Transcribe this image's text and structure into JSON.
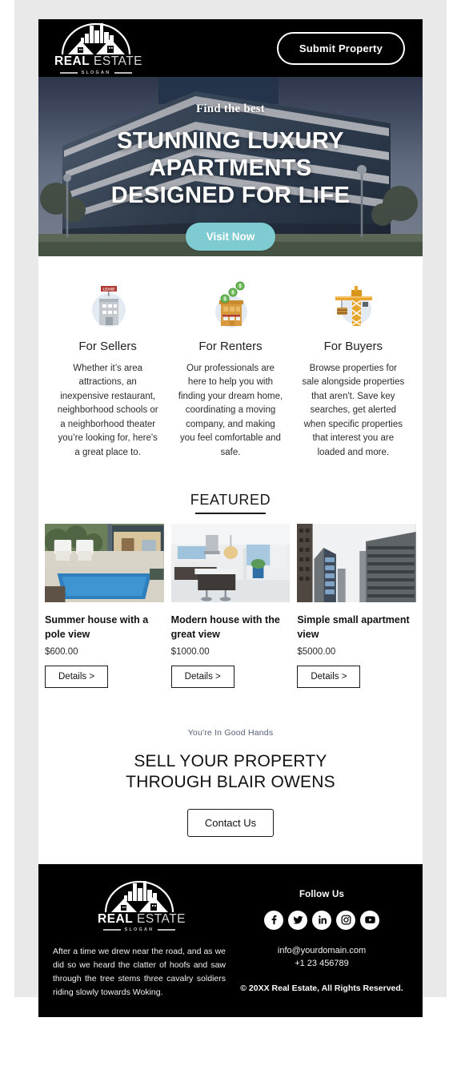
{
  "brand": {
    "logo_word_1": "REAL",
    "logo_word_2": "ESTATE",
    "logo_slogan": "SLOGAN",
    "accent_teal": "#7ecbd1",
    "dark": "#000000",
    "page_gutter": "#e9e9e9"
  },
  "header": {
    "submit_label": "Submit Property"
  },
  "hero": {
    "eyebrow": "Find the best",
    "title_line_1": "STUNNING LUXURY  APARTMENTS",
    "title_line_2": "DESIGNED FOR LIFE",
    "cta_label": "Visit Now"
  },
  "features": [
    {
      "icon": "building-lease-icon",
      "title": "For Sellers",
      "body": "Whether it’s area attractions, an inexpensive restaurant, neighborhood schools or a neighborhood theater you’re looking for, here's a great place to."
    },
    {
      "icon": "building-money-icon",
      "title": "For Renters",
      "body": "Our professionals are here to help you with finding your dream home, coordinating a moving company, and making you feel comfortable and safe."
    },
    {
      "icon": "construction-crane-icon",
      "title": "For Buyers",
      "body": "Browse properties for sale alongside properties that aren't. Save key searches, get alerted when specific properties that interest you are loaded and more."
    }
  ],
  "featured": {
    "heading": "FEATURED",
    "cards": [
      {
        "image": "pool-patio-photo",
        "title": "Summer house with a pole view",
        "price": "$600.00",
        "button": "Details >"
      },
      {
        "image": "modern-kitchen-photo",
        "title": "Modern house with the great view",
        "price": "$1000.00",
        "button": "Details >"
      },
      {
        "image": "city-towers-photo",
        "title": "Simple small apartment view",
        "price": "$5000.00",
        "button": "Details >"
      }
    ]
  },
  "cta": {
    "eyebrow": "You're In Good Hands",
    "title_line_1": "SELL YOUR PROPERTY",
    "title_line_2": "THROUGH BLAIR OWENS",
    "button": "Contact Us"
  },
  "footer": {
    "about_text": "After a time we drew near the road, and as we did so we heard the clatter of hoofs and saw through the tree stems three cavalry soldiers riding slowly towards Woking.",
    "follow_title": "Follow Us",
    "socials": [
      {
        "name": "facebook-icon"
      },
      {
        "name": "twitter-icon"
      },
      {
        "name": "linkedin-icon"
      },
      {
        "name": "instagram-icon"
      },
      {
        "name": "youtube-icon"
      }
    ],
    "email": "info@yourdomain.com",
    "phone": "+1 23 456789",
    "copyright": "© 20XX Real Estate, All Rights Reserved."
  }
}
